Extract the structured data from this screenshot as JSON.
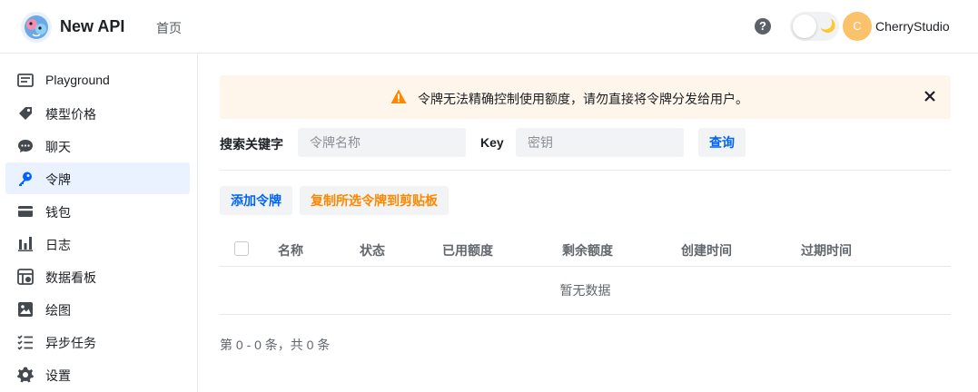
{
  "header": {
    "brand": "New API",
    "nav_home": "首页",
    "help_glyph": "?",
    "theme_toggle_glyph": "🌙",
    "avatar_initial": "C",
    "username": "CherryStudio",
    "avatar_color": "#fbc16b"
  },
  "sidebar": {
    "items": [
      {
        "label": "Playground",
        "icon": "chat-box-icon",
        "active": false
      },
      {
        "label": "模型价格",
        "icon": "price-tag-icon",
        "active": false
      },
      {
        "label": "聊天",
        "icon": "chat-bubble-icon",
        "active": false
      },
      {
        "label": "令牌",
        "icon": "key-icon",
        "active": true
      },
      {
        "label": "钱包",
        "icon": "wallet-card-icon",
        "active": false
      },
      {
        "label": "日志",
        "icon": "bar-chart-icon",
        "active": false
      },
      {
        "label": "数据看板",
        "icon": "dashboard-icon",
        "active": false
      },
      {
        "label": "绘图",
        "icon": "image-icon",
        "active": false
      },
      {
        "label": "异步任务",
        "icon": "task-list-icon",
        "active": false
      },
      {
        "label": "设置",
        "icon": "gear-icon",
        "active": false
      }
    ]
  },
  "banner": {
    "text": "令牌无法精确控制使用额度，请勿直接将令牌分发给用户。",
    "warning_color": "#fc8800"
  },
  "search": {
    "keyword_label": "搜索关键字",
    "name_placeholder": "令牌名称",
    "key_label": "Key",
    "key_placeholder": "密钥",
    "query_button": "查询"
  },
  "actions": {
    "add_token": "添加令牌",
    "copy_selected": "复制所选令牌到剪贴板"
  },
  "table": {
    "columns": [
      "名称",
      "状态",
      "已用额度",
      "剩余额度",
      "创建时间",
      "过期时间"
    ],
    "empty_text": "暂无数据"
  },
  "pagination": {
    "summary": "第 0 - 0 条，共 0 条"
  },
  "colors": {
    "primary": "#0064fa",
    "accent_orange": "#fc8800",
    "active_bg": "#eaf2ff"
  }
}
